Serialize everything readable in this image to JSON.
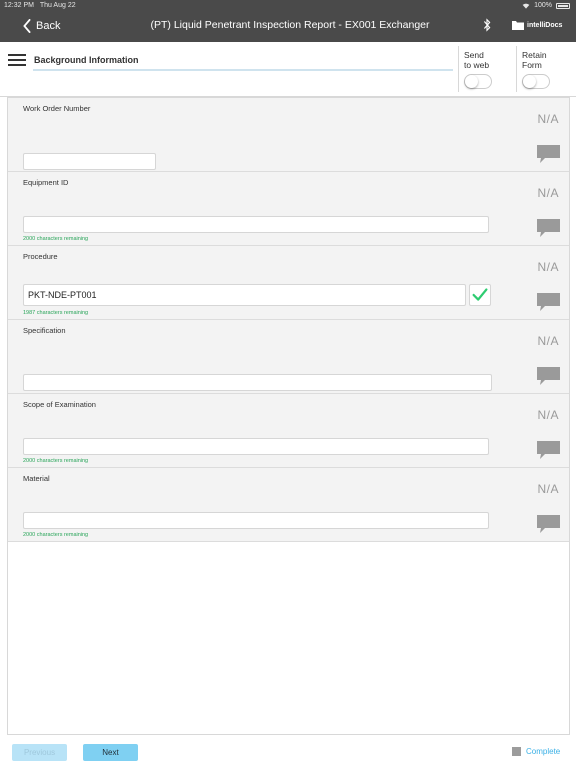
{
  "status_bar": {
    "time": "12:32 PM",
    "date": "Thu Aug 22",
    "battery": "100%"
  },
  "nav": {
    "back_label": "Back",
    "title": "(PT) Liquid Penetrant Inspection Report - EX001 Exchanger",
    "logo_text": "intelliDocs"
  },
  "section": {
    "title": "Background Information",
    "send_to_web_label_1": "Send",
    "send_to_web_label_2": "to web",
    "retain_form_label_1": "Retain",
    "retain_form_label_2": "Form",
    "send_to_web_on": false,
    "retain_form_on": false
  },
  "fields": [
    {
      "label": "Work Order Number",
      "value": "",
      "remaining": "",
      "na": "N/A",
      "valid": false
    },
    {
      "label": "Equipment ID",
      "value": "",
      "remaining": "2000 characters remaining",
      "na": "N/A",
      "valid": false
    },
    {
      "label": "Procedure",
      "value": "PKT-NDE-PT001",
      "remaining": "1987 characters remaining",
      "na": "N/A",
      "valid": true
    },
    {
      "label": "Specification",
      "value": "",
      "remaining": "",
      "na": "N/A",
      "valid": false
    },
    {
      "label": "Scope of Examination",
      "value": "",
      "remaining": "2000 characters remaining",
      "na": "N/A",
      "valid": false
    },
    {
      "label": "Material",
      "value": "",
      "remaining": "2000 characters remaining",
      "na": "N/A",
      "valid": false
    }
  ],
  "footer": {
    "previous_label": "Previous",
    "next_label": "Next",
    "complete_label": "Complete"
  },
  "colors": {
    "nav_bg": "#4a4a4a",
    "accent": "#3ab0e6",
    "valid_green": "#2ecc71",
    "remaining_green": "#2aa55a"
  }
}
